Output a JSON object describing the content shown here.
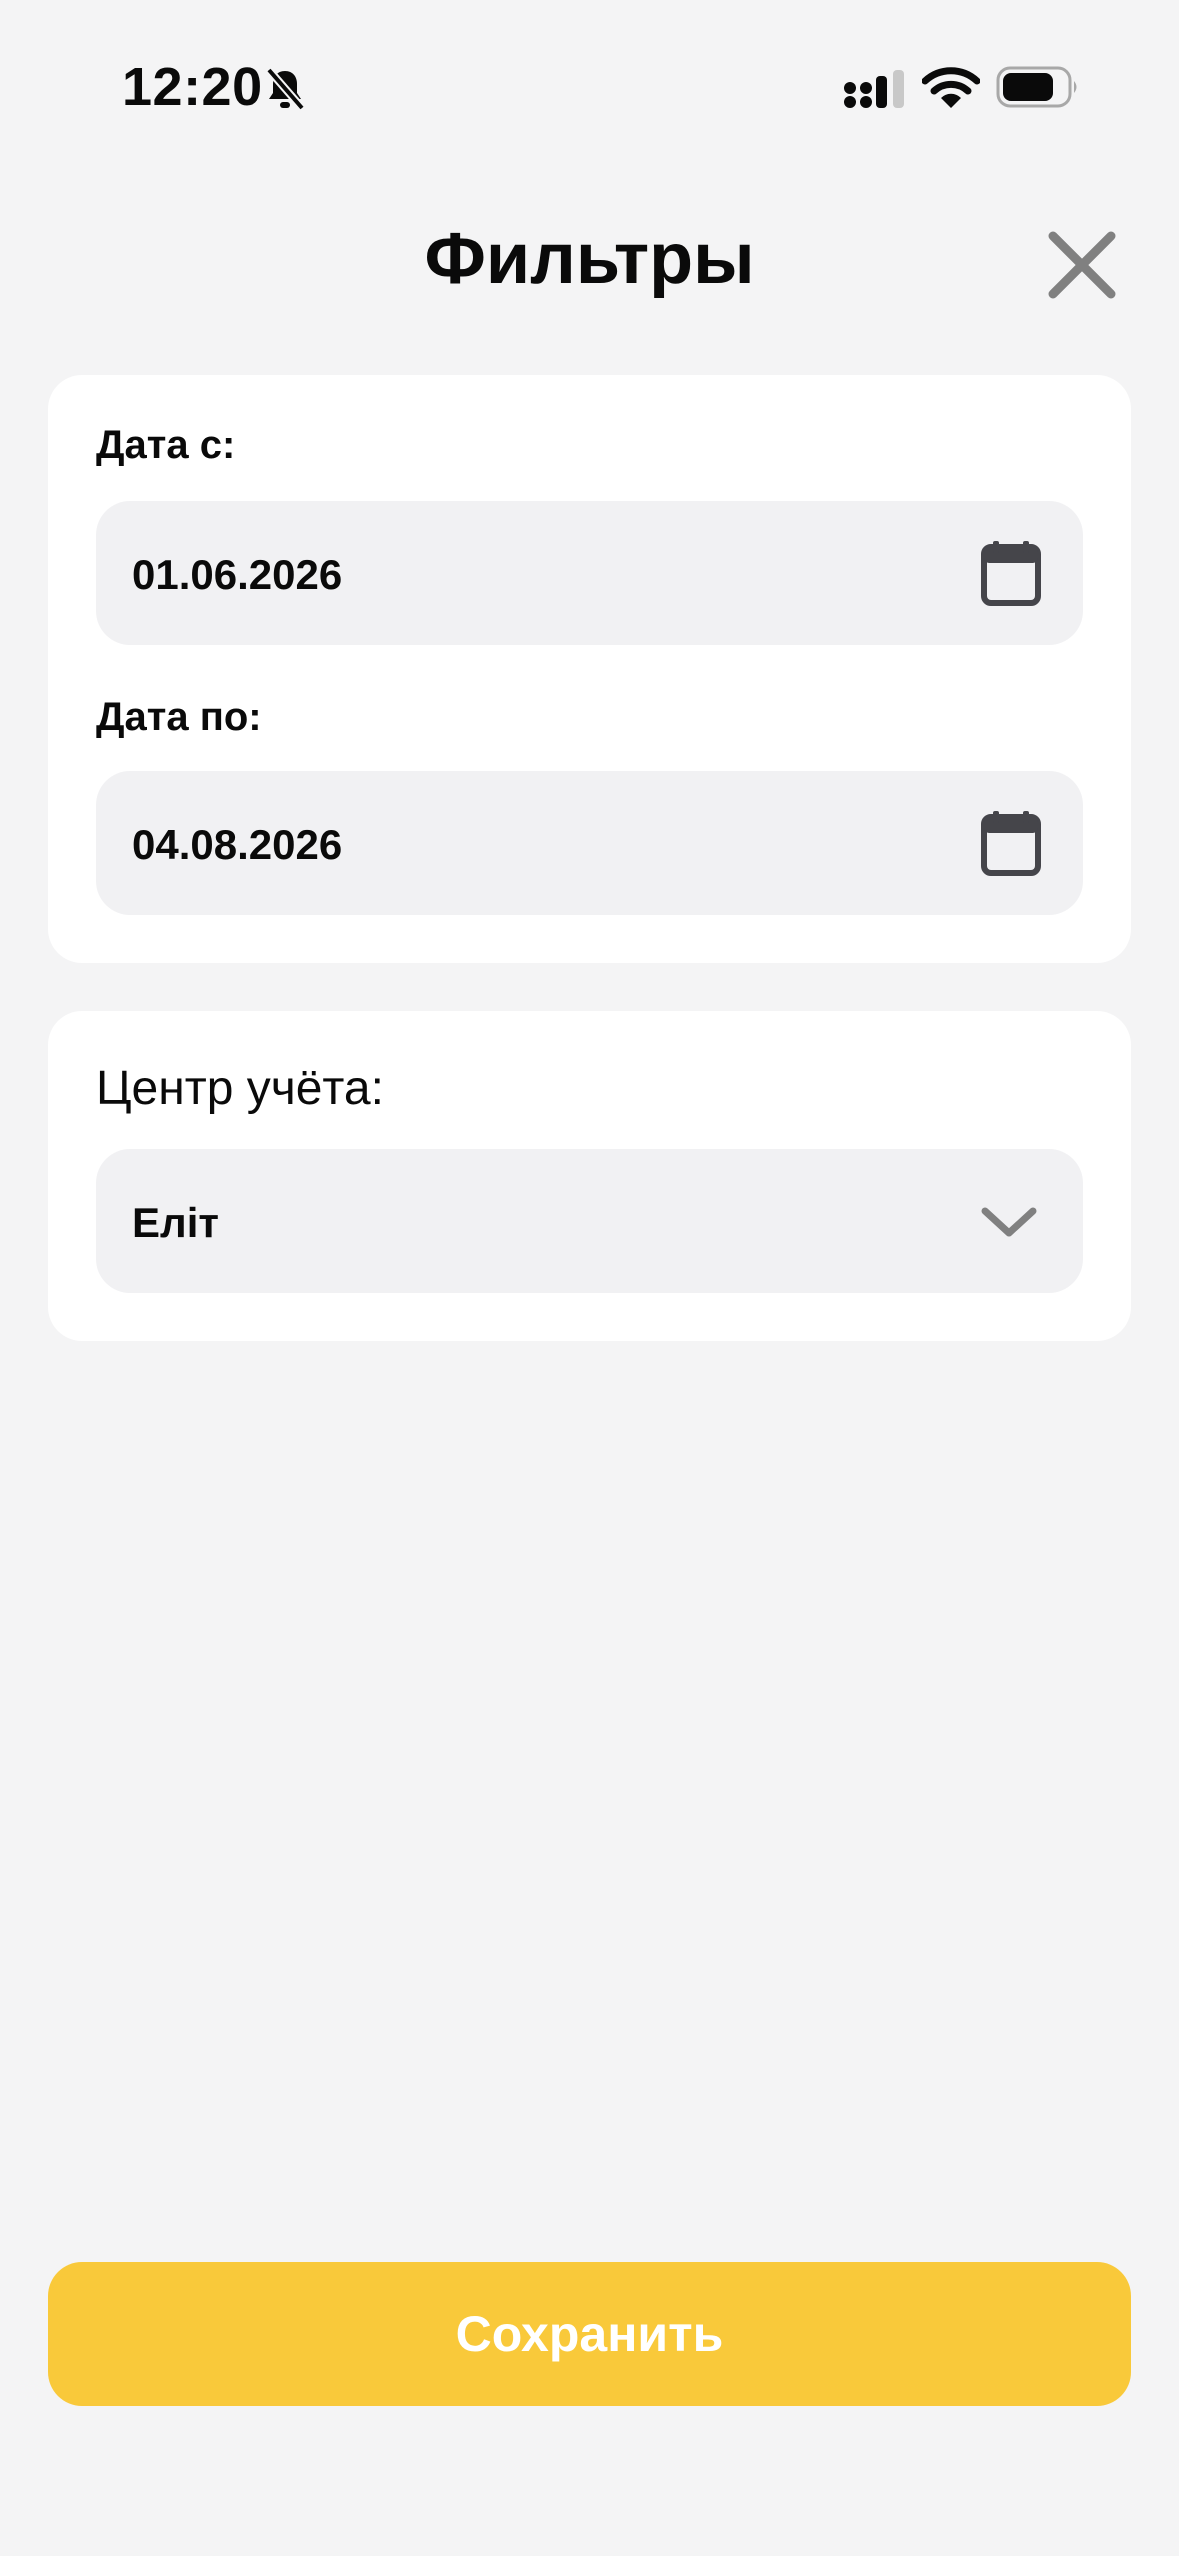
{
  "status_bar": {
    "time": "12:20",
    "icons": [
      "bell-slash-icon",
      "cellular-signal-icon",
      "wifi-icon",
      "battery-icon"
    ]
  },
  "header": {
    "title": "Фильтры",
    "close_icon": "close-icon"
  },
  "date_filter": {
    "from_label": "Дата с:",
    "from_value": "01.06.2026",
    "to_label": "Дата по:",
    "to_value": "04.08.2026",
    "field_icon": "calendar-icon"
  },
  "center_filter": {
    "label": "Центр учёта:",
    "selected": "Еліт",
    "dropdown_icon": "chevron-down-icon"
  },
  "actions": {
    "save_label": "Сохранить"
  },
  "colors": {
    "background": "#f4f4f5",
    "card": "#ffffff",
    "field": "#f1f1f3",
    "accent": "#f9c93a",
    "icon_gray": "#808080"
  }
}
